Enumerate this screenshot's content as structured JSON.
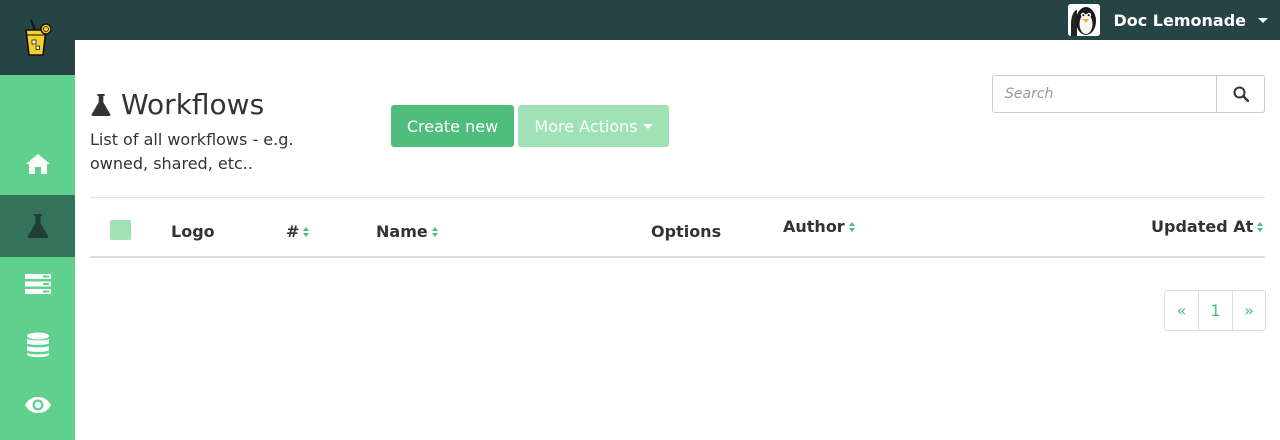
{
  "app": {
    "logo_icon": "lemonade-glass-icon"
  },
  "topbar": {
    "user_name": "Doc Lemonade",
    "avatar_icon": "penguin-avatar",
    "menu_icon": "caret-down-icon",
    "background": "#264444"
  },
  "sidebar": {
    "background": "#5fd08e",
    "active_background": "#33725b",
    "items": [
      {
        "icon": "home-icon",
        "active": false
      },
      {
        "icon": "flask-icon",
        "active": true
      },
      {
        "icon": "server-icon",
        "active": false
      },
      {
        "icon": "database-icon",
        "active": false
      },
      {
        "icon": "eye-icon",
        "active": false
      }
    ]
  },
  "page": {
    "title": "Workflows",
    "title_icon": "flask-icon",
    "description": "List of all workflows - e.g. owned, shared, etc.."
  },
  "actions": {
    "create_label": "Create new",
    "more_label": "More Actions",
    "accent": "#4fbe7c"
  },
  "search": {
    "placeholder": "Search",
    "value": "",
    "button_icon": "search-icon"
  },
  "table": {
    "select_all_checked": false,
    "columns": [
      {
        "label": "Logo",
        "sortable": false
      },
      {
        "label": "#",
        "sortable": true
      },
      {
        "label": "Name",
        "sortable": true
      },
      {
        "label": "Options",
        "sortable": false
      },
      {
        "label": "Author",
        "sortable": true
      },
      {
        "label": "Updated At",
        "sortable": true
      }
    ],
    "rows": []
  },
  "pagination": {
    "prev": "«",
    "pages": [
      "1"
    ],
    "next": "»"
  }
}
